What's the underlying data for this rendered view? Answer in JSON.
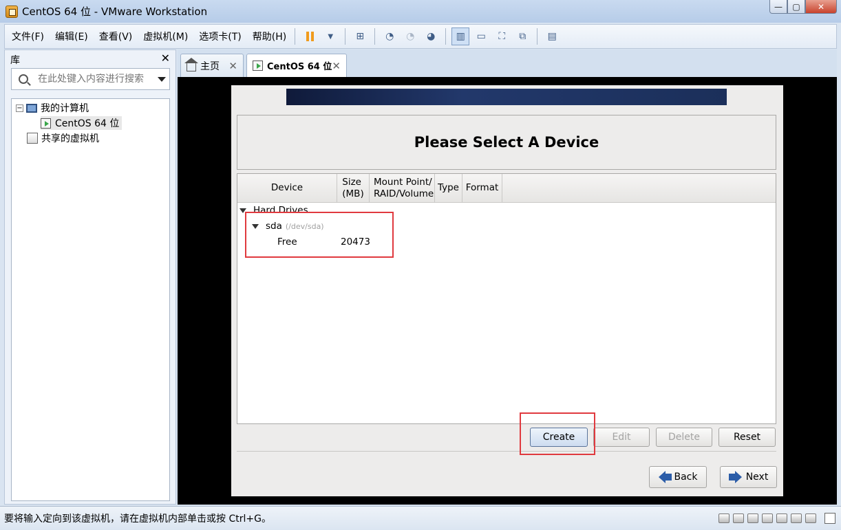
{
  "window": {
    "title": "CentOS 64 位 - VMware Workstation",
    "controls": {
      "minimize": "—",
      "maximize": "▢",
      "close": "✕"
    }
  },
  "menu": {
    "items": [
      "文件(F)",
      "编辑(E)",
      "查看(V)",
      "虚拟机(M)",
      "选项卡(T)",
      "帮助(H)"
    ],
    "toolbar_icons": [
      "pause-icon",
      "send-ctrl-alt-del-icon",
      "snapshot-icon",
      "revert-snapshot-icon",
      "snapshot-manager-icon",
      "library-view-icon",
      "thumbnail-icon",
      "fullscreen-icon",
      "unity-icon",
      "console-view-icon"
    ]
  },
  "library": {
    "title": "库",
    "close": "✕",
    "search_placeholder": "在此处键入内容进行搜索",
    "tree": {
      "my_computer": "我的计算机",
      "vm": "CentOS 64 位",
      "shared": "共享的虚拟机",
      "expander": "−"
    }
  },
  "tabs": {
    "home": "主页",
    "active": "CentOS 64 位",
    "close": "✕"
  },
  "installer": {
    "heading": "Please Select A Device",
    "columns": {
      "device": "Device",
      "size": "Size\n(MB)",
      "mount": "Mount Point/\nRAID/Volume",
      "type": "Type",
      "format": "Format"
    },
    "group": "Hard Drives",
    "disk": {
      "name": "sda",
      "path": "(/dev/sda)"
    },
    "free_row": {
      "label": "Free",
      "size": "20473"
    },
    "buttons": {
      "create": "Create",
      "edit": "Edit",
      "delete": "Delete",
      "reset": "Reset",
      "back": "Back",
      "next": "Next"
    }
  },
  "statusbar": {
    "message": "要将输入定向到该虚拟机，请在虚拟机内部单击或按 Ctrl+G。"
  },
  "colors": {
    "highlight_box": "#e0393e",
    "console_bg": "#000000",
    "installer_bg": "#edeceb"
  }
}
